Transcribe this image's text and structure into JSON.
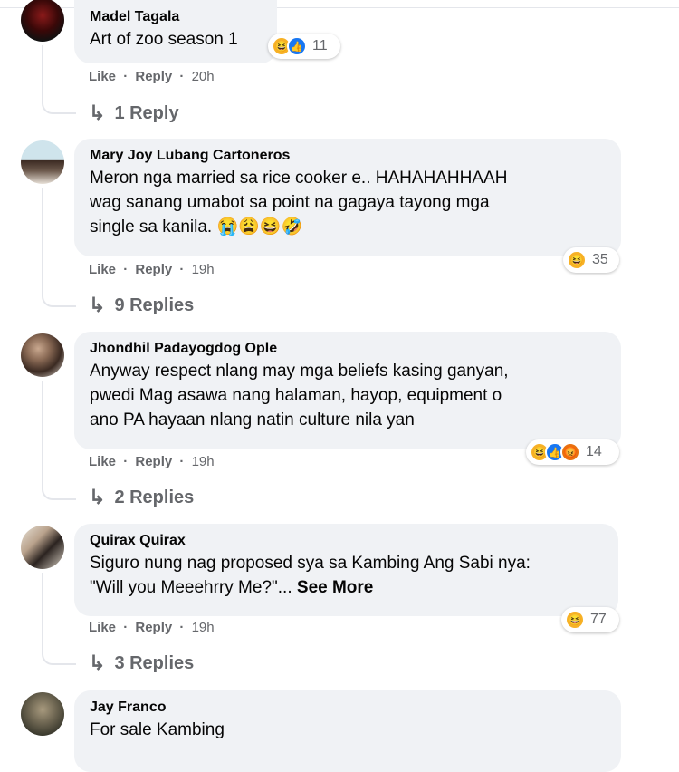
{
  "comments": [
    {
      "name": "Madel Tagala",
      "lines": [
        "Art of zoo season 1"
      ],
      "reactions": {
        "icons": [
          "haha-icon",
          "like-icon"
        ],
        "count": "11"
      },
      "actions": {
        "like": "Like",
        "reply": "Reply",
        "time": "20h"
      },
      "replies": "1 Reply"
    },
    {
      "name": "Mary Joy Lubang Cartoneros",
      "lines": [
        "Meron nga married sa rice cooker e.. HAHAHAHHAAH",
        "wag sanang umabot sa point na gagaya tayong mga",
        "single sa kanila. 😭😩😆🤣"
      ],
      "reactions": {
        "icons": [
          "haha-icon"
        ],
        "count": "35"
      },
      "actions": {
        "like": "Like",
        "reply": "Reply",
        "time": "19h"
      },
      "replies": "9 Replies"
    },
    {
      "name": "Jhondhil Padayogdog Ople",
      "lines": [
        "Anyway respect nlang may mga beliefs kasing ganyan,",
        "pwedi Mag asawa nang halaman, hayop, equipment o",
        "ano PA hayaan nlang natin culture nila yan"
      ],
      "reactions": {
        "icons": [
          "haha-icon",
          "like-icon",
          "angry-icon"
        ],
        "count": "14"
      },
      "actions": {
        "like": "Like",
        "reply": "Reply",
        "time": "19h"
      },
      "replies": "2 Replies"
    },
    {
      "name": "Quirax Quirax",
      "lines": [
        "Siguro nung nag proposed sya sa Kambing Ang Sabi nya:",
        "\"Will you Meeehrry Me?\"..."
      ],
      "see_more": "See More",
      "reactions": {
        "icons": [
          "haha-icon"
        ],
        "count": "77"
      },
      "actions": {
        "like": "Like",
        "reply": "Reply",
        "time": "19h"
      },
      "replies": "3 Replies"
    },
    {
      "name": "Jay Franco",
      "lines": [
        "For sale Kambing"
      ]
    }
  ],
  "separator": "·"
}
